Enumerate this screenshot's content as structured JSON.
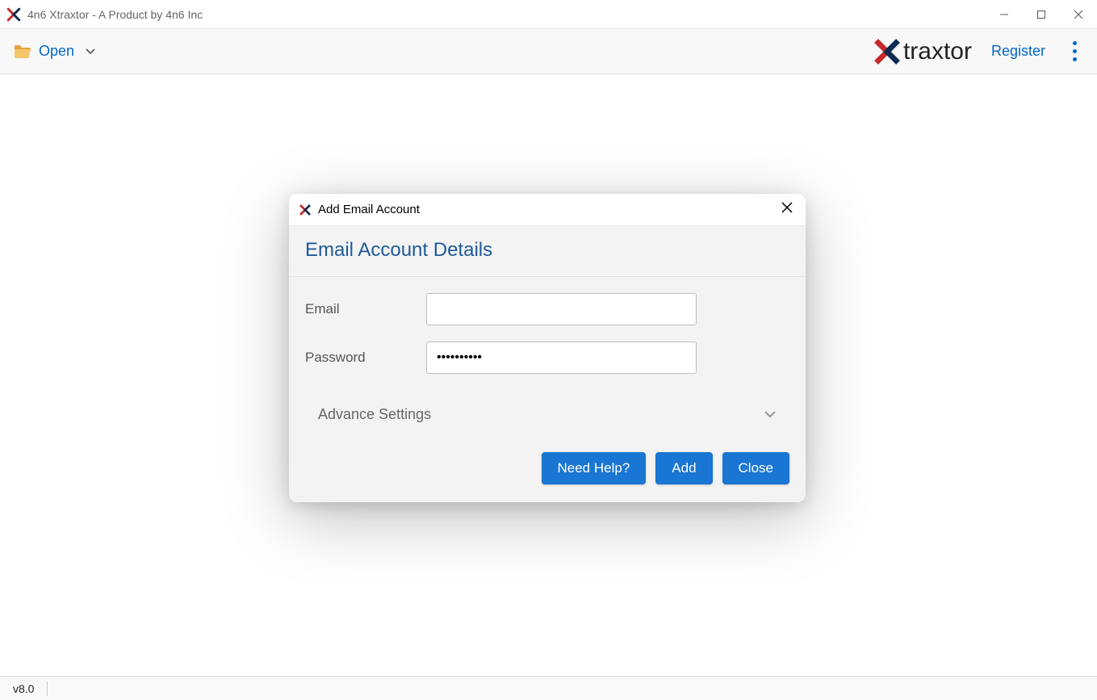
{
  "window": {
    "title": "4n6 Xtraxtor - A Product by 4n6 Inc"
  },
  "toolbar": {
    "open_label": "Open",
    "brand_name": "traxtor",
    "register_label": "Register"
  },
  "dialog": {
    "title": "Add Email Account",
    "heading": "Email Account Details",
    "email_label": "Email",
    "email_value": "",
    "password_label": "Password",
    "password_value": "••••••••••",
    "advance_label": "Advance Settings",
    "buttons": {
      "help": "Need Help?",
      "add": "Add",
      "close": "Close"
    }
  },
  "statusbar": {
    "version": "v8.0"
  }
}
